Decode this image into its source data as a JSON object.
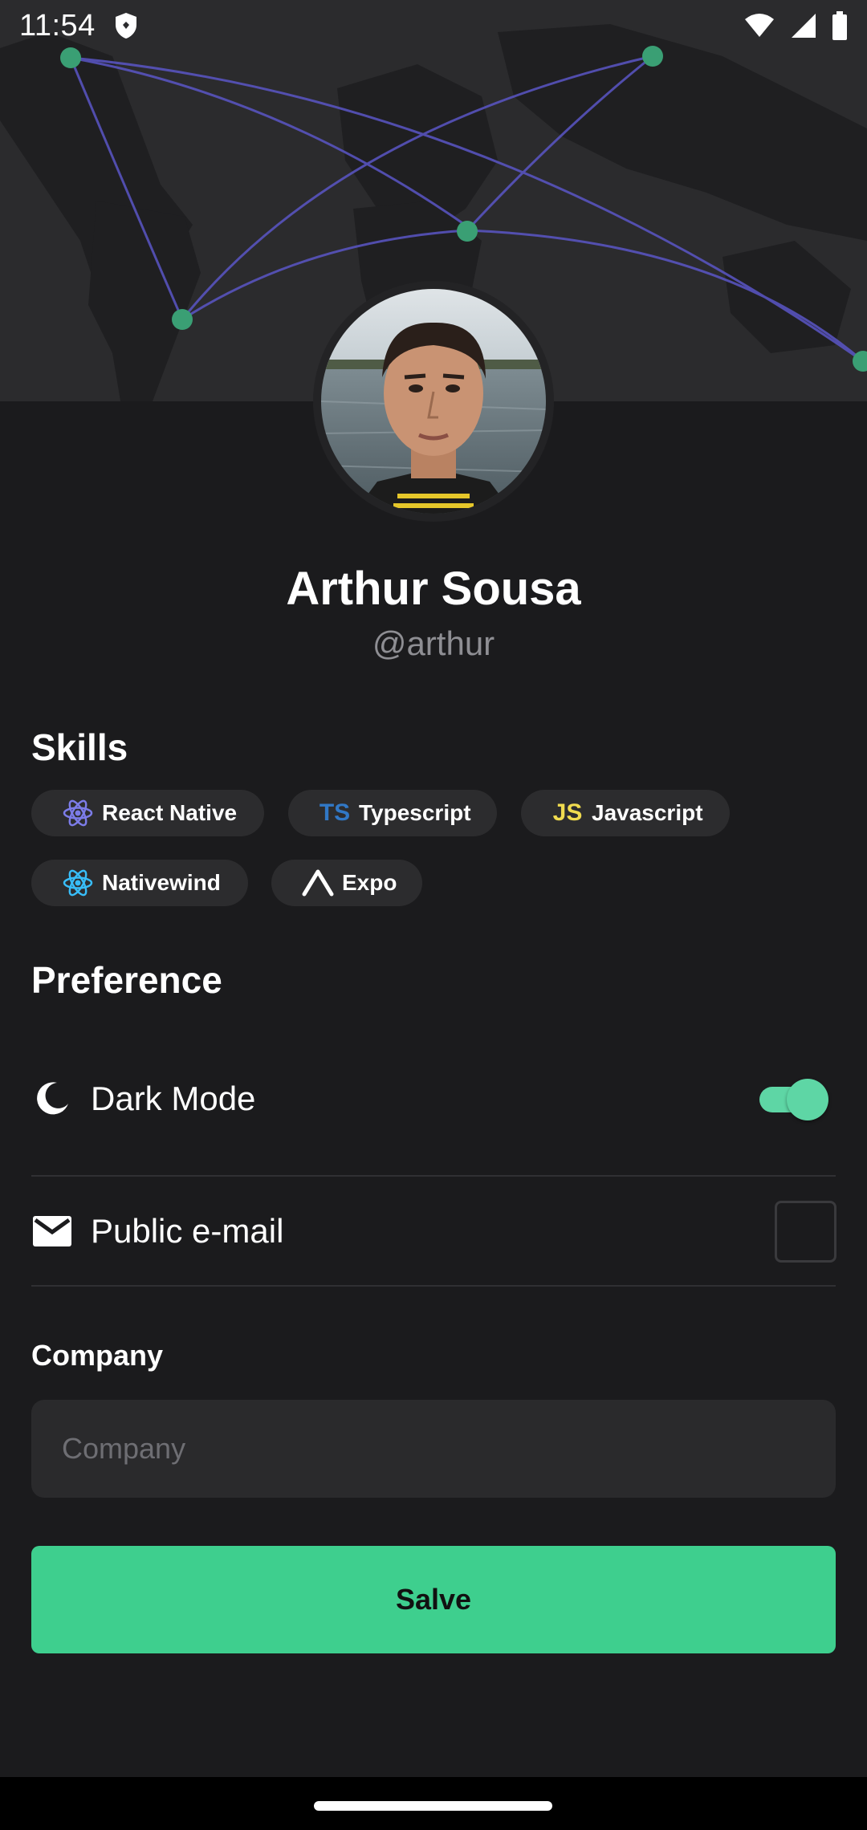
{
  "status_bar": {
    "time": "11:54",
    "icons": [
      "shield-icon",
      "wifi-icon",
      "cell-signal-icon",
      "battery-icon"
    ]
  },
  "profile": {
    "name": "Arthur Sousa",
    "handle": "@arthur"
  },
  "skills": {
    "title": "Skills",
    "items": [
      {
        "label": "React Native",
        "icon": "react-icon",
        "badge": ""
      },
      {
        "label": "Typescript",
        "icon": "typescript-icon",
        "badge": "TS"
      },
      {
        "label": "Javascript",
        "icon": "javascript-icon",
        "badge": "JS"
      },
      {
        "label": "Nativewind",
        "icon": "nativewind-icon",
        "badge": ""
      },
      {
        "label": "Expo",
        "icon": "expo-icon",
        "badge": ""
      }
    ]
  },
  "preference": {
    "title": "Preference",
    "dark_mode": {
      "label": "Dark Mode",
      "icon": "moon-icon",
      "enabled": true
    },
    "public_email": {
      "label": "Public e-mail",
      "icon": "mail-icon",
      "checked": false
    }
  },
  "company": {
    "label": "Company",
    "placeholder": "Company",
    "value": ""
  },
  "save_button": {
    "label": "Salve"
  },
  "colors": {
    "background": "#1b1b1d",
    "surface": "#2c2c2e",
    "accent": "#3ecf8e",
    "toggle_on": "#5ed6a5",
    "typescript": "#3178c6",
    "javascript": "#f0db4f",
    "react": "#7c7ce8",
    "nativewind": "#38bdf8"
  }
}
